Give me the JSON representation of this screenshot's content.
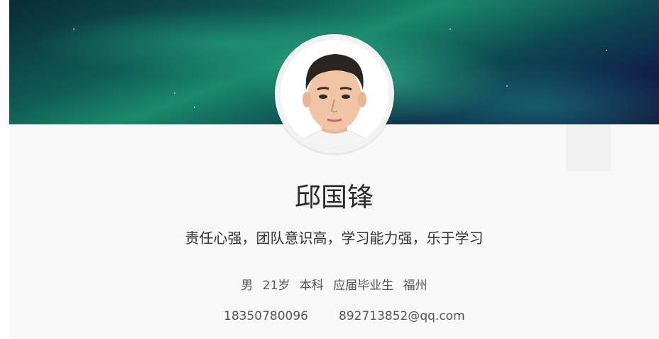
{
  "profile": {
    "name": "邱国锋",
    "motto": "责任心强，团队意识高，学习能力强，乐于学习",
    "info": {
      "gender": "男",
      "age": "21岁",
      "education": "本科",
      "status": "应届毕业生",
      "city": "福州"
    },
    "contact": {
      "phone": "18350780096",
      "email": "892713852@qq.com"
    }
  },
  "colors": {
    "card_background": "#f8f8f8",
    "banner_primary": "#0f5a55",
    "banner_accent": "#1a8a6a",
    "banner_dark": "#131a3f"
  }
}
